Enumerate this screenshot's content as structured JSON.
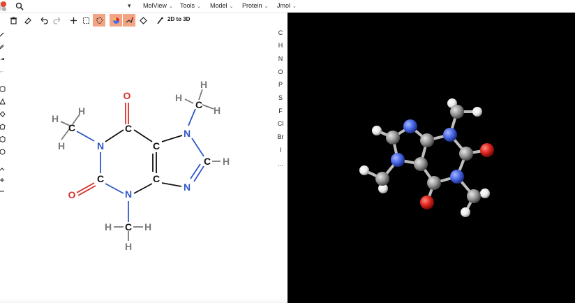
{
  "menubar": {
    "items": [
      {
        "label": "MolView",
        "icon": "chevron-down-icon"
      },
      {
        "label": "Tools",
        "icon": "chevron-down-icon"
      },
      {
        "label": "Model",
        "icon": "chevron-down-icon"
      },
      {
        "label": "Protein",
        "icon": "chevron-down-icon"
      },
      {
        "label": "Jmol",
        "icon": "chevron-down-icon"
      }
    ]
  },
  "toolbar": {
    "convert_label": "2D to 3D",
    "tools": [
      "trash-icon",
      "eraser-icon",
      "undo-icon",
      "redo-icon",
      "move-icon",
      "rect-select-icon",
      "lasso-select-icon",
      "color-mode-icon",
      "skeletal-mode-icon",
      "center-icon",
      "clean-icon"
    ],
    "active_tools": [
      "lasso-select-icon",
      "color-mode-icon",
      "skeletal-mode-icon"
    ],
    "accent_color": "#f3a583"
  },
  "elements": [
    "C",
    "H",
    "N",
    "O",
    "P",
    "S",
    "F",
    "Cl",
    "Br",
    "I",
    "..."
  ],
  "structure_2d": {
    "atoms": [
      "O",
      "C",
      "C",
      "N",
      "C",
      "H",
      "H",
      "H",
      "H",
      "H",
      "H",
      "N",
      "C",
      "C",
      "C",
      "N",
      "H",
      "N",
      "H",
      "H",
      "H",
      "C",
      "O"
    ],
    "colors": {
      "carbon": "#111111",
      "nitrogen": "#2e57c8",
      "oxygen": "#d6322a",
      "hydrogen": "#7a7a7a"
    }
  },
  "viewer_3d": {
    "background": "#000000",
    "atom_colors": {
      "carbon": "#8f8f8f",
      "nitrogen": "#4a6ae8",
      "oxygen": "#e0261f",
      "hydrogen": "#ffffff"
    }
  }
}
